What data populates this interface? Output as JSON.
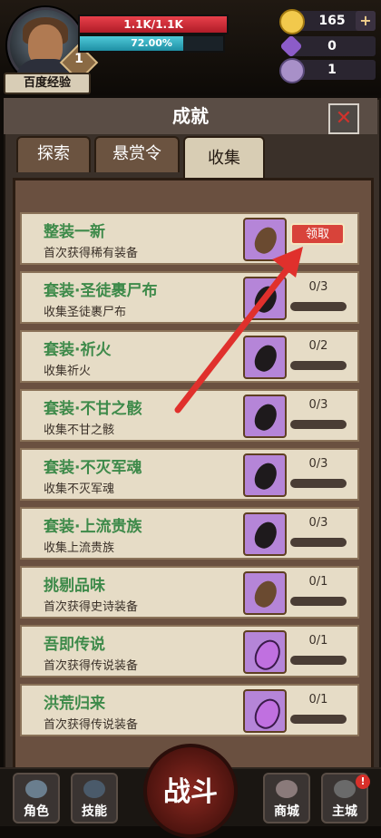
{
  "player": {
    "name": "百度经验",
    "level": "1",
    "hp_text": "1.1K/1.1K",
    "hp_fraction": 1.0,
    "xp_text": "72.00%",
    "xp_fraction": 0.72
  },
  "resources": [
    {
      "value": "165",
      "icon": "gold-coin-icon",
      "color": "#f2c94c",
      "plus": "+"
    },
    {
      "value": "0",
      "icon": "purple-crystal-icon",
      "color": "#8c5cc8"
    },
    {
      "value": "1",
      "icon": "ram-horn-icon",
      "color": "#a890c8"
    }
  ],
  "panel": {
    "title": "成就",
    "close": "✕"
  },
  "tabs": [
    {
      "label": "探索",
      "active": false
    },
    {
      "label": "悬赏令",
      "active": false
    },
    {
      "label": "收集",
      "active": true
    }
  ],
  "achievements": [
    {
      "title": "整装一新",
      "desc": "首次获得稀有装备",
      "progress": "",
      "claim": "领取",
      "icon": "pouch-icon"
    },
    {
      "title": "套装·圣徒裹尸布",
      "desc": "收集圣徒裹尸布",
      "progress": "0/3",
      "icon": "dark-gem-icon"
    },
    {
      "title": "套装·祈火",
      "desc": "收集祈火",
      "progress": "0/2",
      "icon": "dark-gem-icon"
    },
    {
      "title": "套装·不甘之骸",
      "desc": "收集不甘之骸",
      "progress": "0/3",
      "icon": "dark-gem-icon"
    },
    {
      "title": "套装·不灭军魂",
      "desc": "收集不灭军魂",
      "progress": "0/3",
      "icon": "dark-gem-icon"
    },
    {
      "title": "套装·上流贵族",
      "desc": "收集上流贵族",
      "progress": "0/3",
      "icon": "dark-gem-icon"
    },
    {
      "title": "挑剔品味",
      "desc": "首次获得史诗装备",
      "progress": "0/1",
      "icon": "pouch-icon"
    },
    {
      "title": "吾即传说",
      "desc": "首次获得传说装备",
      "progress": "0/1",
      "icon": "purple-gem-icon"
    },
    {
      "title": "洪荒归来",
      "desc": "首次获得传说装备",
      "progress": "0/1",
      "icon": "purple-gem-icon"
    }
  ],
  "nav": {
    "role": "角色",
    "skills": "技能",
    "battle": "战斗",
    "shop": "商城",
    "city": "主城",
    "badge": "!"
  }
}
